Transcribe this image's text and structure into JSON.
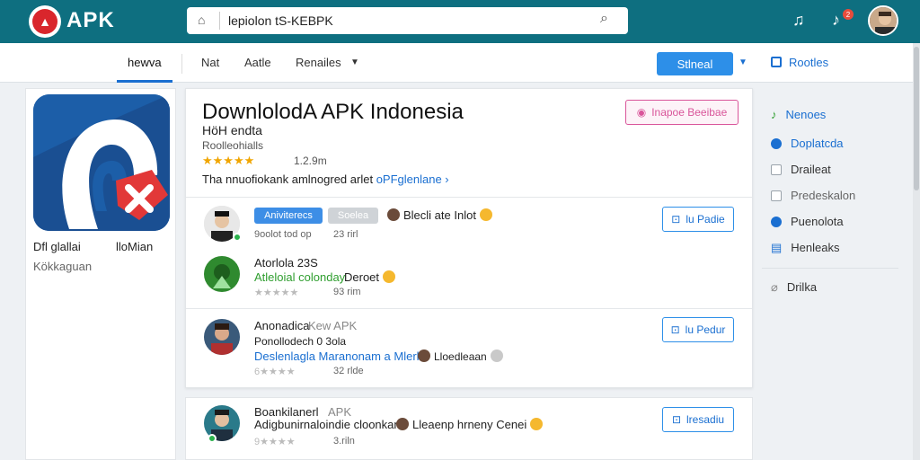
{
  "topbar": {
    "brand": "APK",
    "search_value": "lepiolon tS-KEBPK",
    "badge_count": "2"
  },
  "nav": {
    "tabs": [
      "hewva",
      "Nat",
      "Aatle",
      "Renailes"
    ],
    "primary_button": "Stlneal",
    "results_label": "Rootles"
  },
  "left_card": {
    "line1_a": "Dfl glallai",
    "line1_b": "lloMian",
    "line2": "Kökkaguan"
  },
  "app": {
    "title": "DownlolodA APK Indonesia",
    "subtitle": "HöH endta",
    "meta": "Roolleohialls",
    "stars": "★★★★★",
    "rating": "1.2.9m",
    "desc_prefix": "Tha nnuofiokank amlnogred arlet",
    "desc_link": "oPFglenlane ›",
    "top_button": "Inapoe Beeibae"
  },
  "rows": [
    {
      "chip1": "Aniviterecs",
      "chip2": "Soelea",
      "name": "Blecli ate Inlot",
      "sub": "9oolot tod   op",
      "size": "23 rirl",
      "button": "lu Padie"
    },
    {
      "title": "Atorlola 23S",
      "line": "Atleloial colonday",
      "line_b": "Deroet",
      "stars": "★★★★★",
      "size": "93 rim"
    },
    {
      "title": "Anonadica",
      "title_b": "Kew APK",
      "line": "Ponollodech 0 3ola",
      "line2": "Deslenlagla Maranonam a Mlerl",
      "line2_b": "Lloedleaan",
      "stars": "6★★★★",
      "size": "32 rlde",
      "button": "lu Pedur"
    },
    {
      "title": "Boankilanerl",
      "title_b": "APK",
      "line": "Adigbunirnaloindie cloonkand",
      "line_b": "Lleaenp hrneny Cenei",
      "stars": "9★★★★",
      "size": "3.riln",
      "button": "lresadiu"
    }
  ],
  "right_panel": {
    "items": [
      "Nenoes",
      "Doplatcda",
      "Draileat",
      "Predeskalon",
      "Puenolota",
      "Henleaks",
      "Drilka"
    ]
  }
}
